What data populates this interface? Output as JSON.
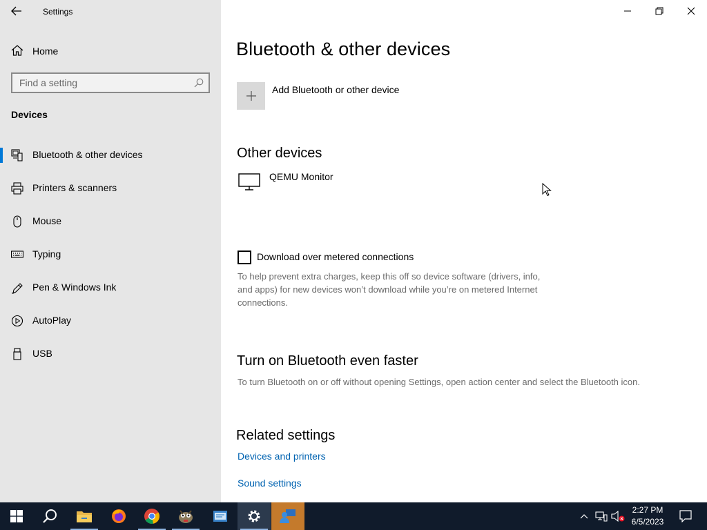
{
  "window": {
    "app_title": "Settings"
  },
  "sidebar": {
    "home_label": "Home",
    "search_placeholder": "Find a setting",
    "section_heading": "Devices",
    "items": [
      {
        "label": "Bluetooth & other devices",
        "icon": "bluetooth-devices-icon",
        "selected": true
      },
      {
        "label": "Printers & scanners",
        "icon": "printer-icon",
        "selected": false
      },
      {
        "label": "Mouse",
        "icon": "mouse-icon",
        "selected": false
      },
      {
        "label": "Typing",
        "icon": "keyboard-icon",
        "selected": false
      },
      {
        "label": "Pen & Windows Ink",
        "icon": "pen-icon",
        "selected": false
      },
      {
        "label": "AutoPlay",
        "icon": "autoplay-icon",
        "selected": false
      },
      {
        "label": "USB",
        "icon": "usb-icon",
        "selected": false
      }
    ]
  },
  "main": {
    "title": "Bluetooth & other devices",
    "add_device_label": "Add Bluetooth or other device",
    "other_devices_heading": "Other devices",
    "devices": [
      {
        "name": "QEMU Monitor",
        "icon": "monitor-icon"
      }
    ],
    "metered": {
      "checkbox_label": "Download over metered connections",
      "checked": false,
      "description": "To help prevent extra charges, keep this off so device software (drivers, info, and apps) for new devices won’t download while you’re on metered Internet connections."
    },
    "faster": {
      "heading": "Turn on Bluetooth even faster",
      "description": "To turn Bluetooth on or off without opening Settings, open action center and select the Bluetooth icon."
    },
    "related": {
      "heading": "Related settings",
      "links": [
        "Devices and printers",
        "Sound settings"
      ]
    }
  },
  "taskbar": {
    "apps": [
      "start-icon",
      "search-icon",
      "file-explorer-icon",
      "firefox-icon",
      "chrome-icon",
      "gimp-icon",
      "notepad-app-icon",
      "settings-icon",
      "people-icon"
    ],
    "time": "2:27 PM",
    "date": "6/5/2023"
  },
  "colors": {
    "accent": "#0078d7",
    "link": "#0063b1",
    "sidebar_bg": "#e6e6e6",
    "taskbar_bg": "#101b2b"
  }
}
